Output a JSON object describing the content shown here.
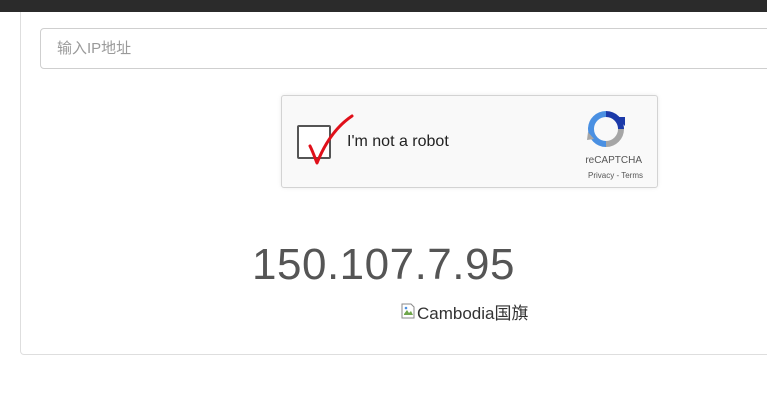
{
  "search": {
    "placeholder": "输入IP地址",
    "value": ""
  },
  "recaptcha": {
    "label": "I'm not a robot",
    "brand": "reCAPTCHA",
    "privacy": "Privacy",
    "separator": " - ",
    "terms": "Terms",
    "checked": true
  },
  "result": {
    "ip": "150.107.7.95",
    "flag_alt": "Cambodia国旗"
  },
  "colors": {
    "top_bar": "#2b2b2b",
    "check_mark": "#e0101a",
    "ip_text": "#555555"
  }
}
